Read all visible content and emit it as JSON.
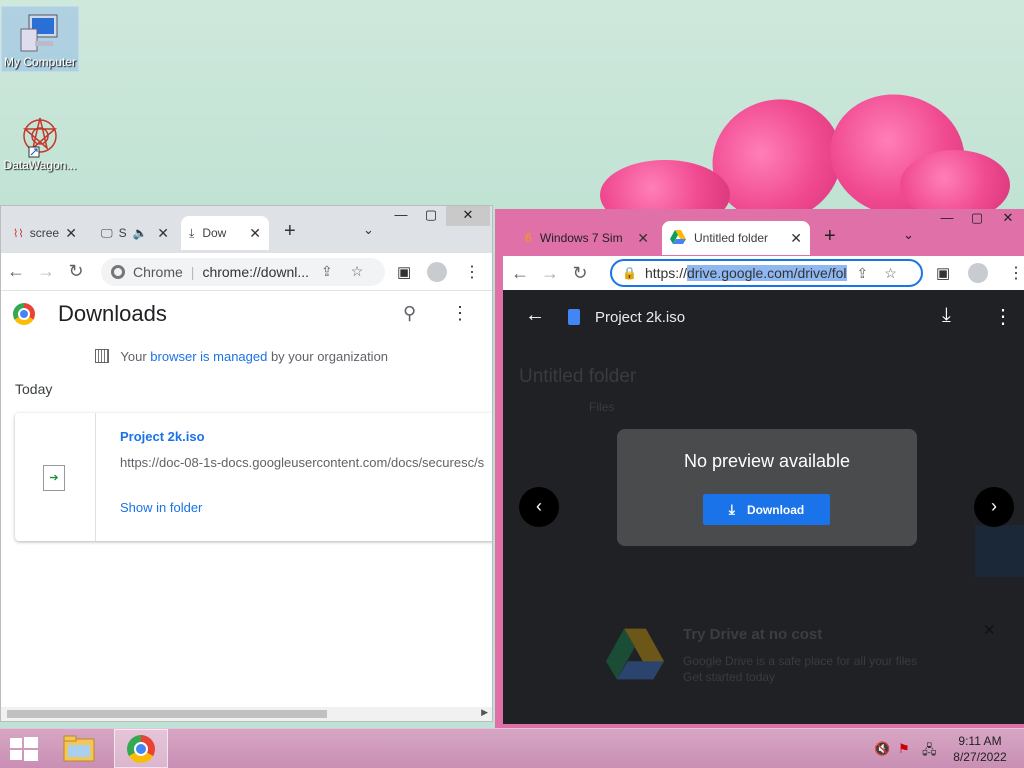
{
  "desktop": {
    "icons": [
      {
        "label": "My Computer"
      },
      {
        "label": "DataWagon..."
      }
    ]
  },
  "downloads_window": {
    "tabs": [
      {
        "label": "scree"
      },
      {
        "label": "S"
      },
      {
        "label": "Dow"
      }
    ],
    "new_tab": "+",
    "address_prefix": "Chrome",
    "address": "chrome://downl...",
    "page_title": "Downloads",
    "managed_prefix": "Your ",
    "managed_link": "browser is managed",
    "managed_suffix": " by your organization",
    "section": "Today",
    "item": {
      "name": "Project 2k.iso",
      "url": "https://doc-08-1s-docs.googleusercontent.com/docs/securesc/s",
      "show_in_folder": "Show in folder"
    }
  },
  "drive_window": {
    "tabs": [
      {
        "label": "Windows 7 Sim"
      },
      {
        "label": "Untitled folder"
      }
    ],
    "new_tab": "+",
    "address_scheme": "https://",
    "address_highlight": "drive.google.com/drive/fol",
    "file_name": "Project 2k.iso",
    "bg_folder_title": "Untitled folder",
    "bg_files_label": "Files",
    "no_preview": "No preview available",
    "download_button": "Download",
    "promo_title": "Try Drive at no cost",
    "promo_line1": "Google Drive is a safe place for all your files",
    "promo_line2": "Get started today"
  },
  "taskbar": {
    "time": "9:11 AM",
    "date": "8/27/2022"
  },
  "colors": {
    "accent_blue": "#1a73e8",
    "chrome_tab_bg": "#dee1e6",
    "drive_frame": "#e070a8",
    "viewer_bg": "#202124"
  }
}
